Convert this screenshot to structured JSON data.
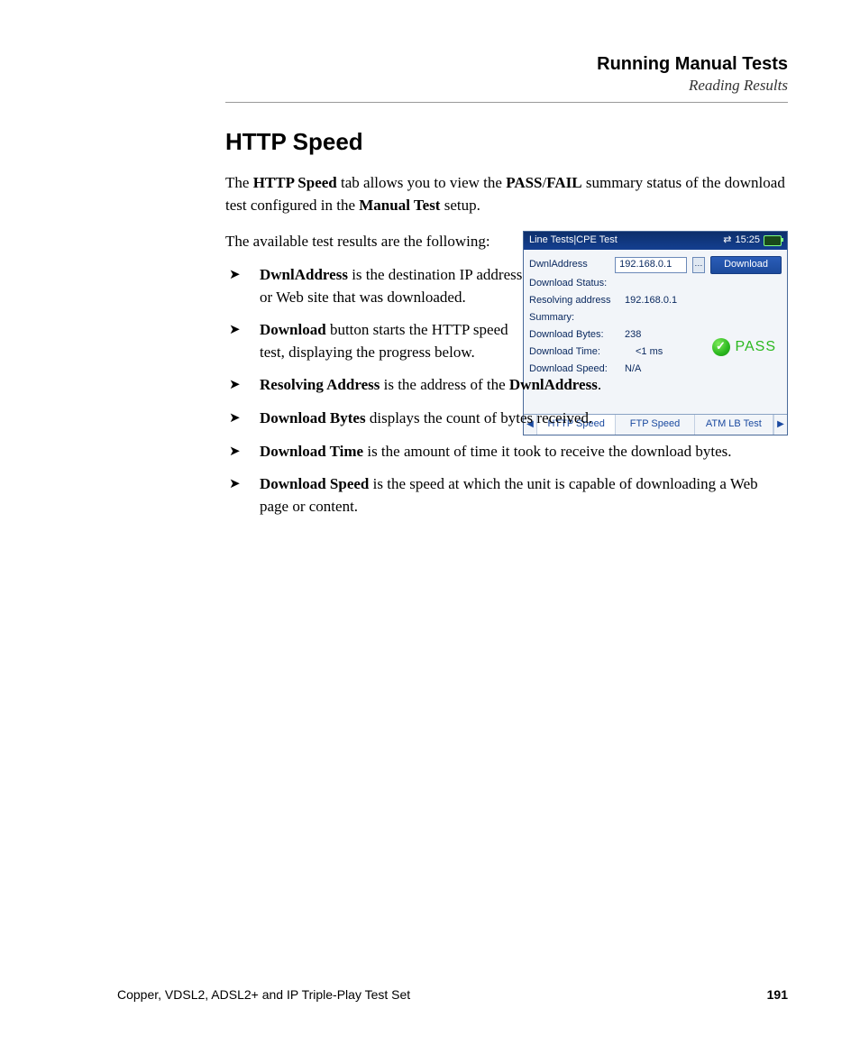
{
  "header": {
    "title": "Running Manual Tests",
    "subtitle": "Reading Results"
  },
  "section": {
    "title": "HTTP Speed",
    "intro_pre": "The ",
    "intro_b1": "HTTP Speed",
    "intro_mid1": " tab allows you to view the ",
    "intro_b2": "PASS",
    "intro_slash": "/",
    "intro_b3": "FAIL",
    "intro_mid2": " summary status of the download test configured in the ",
    "intro_b4": "Manual Test",
    "intro_end": " setup.",
    "avail": "The available test results are the following:"
  },
  "bullets_narrow": [
    {
      "term": "DwnlAddress",
      "rest": " is the destination IP address or Web site that was downloaded."
    },
    {
      "term": "Download",
      "rest": " button starts the HTTP speed test, displaying the progress below."
    }
  ],
  "bullets_full": [
    {
      "term": "Resolving Address",
      "mid": " is the address of the ",
      "term2": "DwnlAddress",
      "rest": "."
    },
    {
      "term": "Download Bytes",
      "rest": " displays the count of bytes received."
    },
    {
      "term": "Download Time",
      "rest": " is the amount of time it took to receive the download bytes."
    },
    {
      "term": "Download Speed",
      "rest": " is the speed at which the unit is capable of downloading a Web page or content."
    }
  ],
  "device": {
    "breadcrumb": "Line Tests|CPE Test",
    "time": "15:25",
    "fields": {
      "dwnl_label": "DwnlAddress",
      "dwnl_value": "192.168.0.1",
      "download_btn": "Download",
      "dl_status_label": "Download Status:",
      "resolving_label": "Resolving address",
      "resolving_value": "192.168.0.1",
      "summary_label": "Summary:",
      "bytes_label": "Download Bytes:",
      "bytes_value": "238",
      "time_label": "Download Time:",
      "time_value": "<1 ms",
      "speed_label": "Download Speed:",
      "speed_value": "N/A"
    },
    "pass": "PASS",
    "tabs": [
      "HTTP Speed",
      "FTP Speed",
      "ATM LB Test"
    ]
  },
  "footer": {
    "left": "Copper, VDSL2, ADSL2+ and IP Triple-Play Test Set",
    "page": "191"
  }
}
